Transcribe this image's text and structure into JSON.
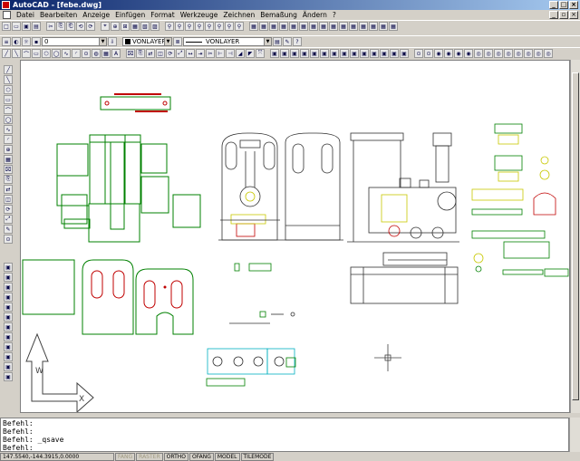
{
  "window": {
    "title": "AutoCAD - [febe.dwg]"
  },
  "menu": {
    "items": [
      "Datei",
      "Bearbeiten",
      "Anzeige",
      "Einfügen",
      "Format",
      "Werkzeuge",
      "Zeichnen",
      "Bemaßung",
      "Ändern",
      "?"
    ]
  },
  "properties": {
    "layer_value": "0",
    "color_value": "VONLAYER",
    "linetype_value": "VONLAYER"
  },
  "commandline": {
    "lines": [
      "Befehl:",
      "Befehl:",
      "Befehl: _qsave",
      "Befehl:"
    ]
  },
  "status": {
    "coords": "147.5540,-144.3915,0.0000",
    "modes": [
      {
        "label": "FANG",
        "on": false
      },
      {
        "label": "RASTER",
        "on": false
      },
      {
        "label": "ORTHO",
        "on": true
      },
      {
        "label": "OFANG",
        "on": true
      },
      {
        "label": "MODEL",
        "on": true
      },
      {
        "label": "TILEMODE",
        "on": true
      }
    ]
  },
  "colors": {
    "title_start": "#0a246a",
    "title_end": "#a6caf0",
    "outline_green": "#008000",
    "outline_red": "#c00000",
    "outline_yellow": "#c8c800",
    "outline_cyan": "#00b0c0"
  },
  "icons": {
    "app": "autocad-icon",
    "doc": "drawing-document-icon",
    "minimize": "minimize-icon",
    "maximize": "maximize-icon",
    "close": "close-icon"
  }
}
